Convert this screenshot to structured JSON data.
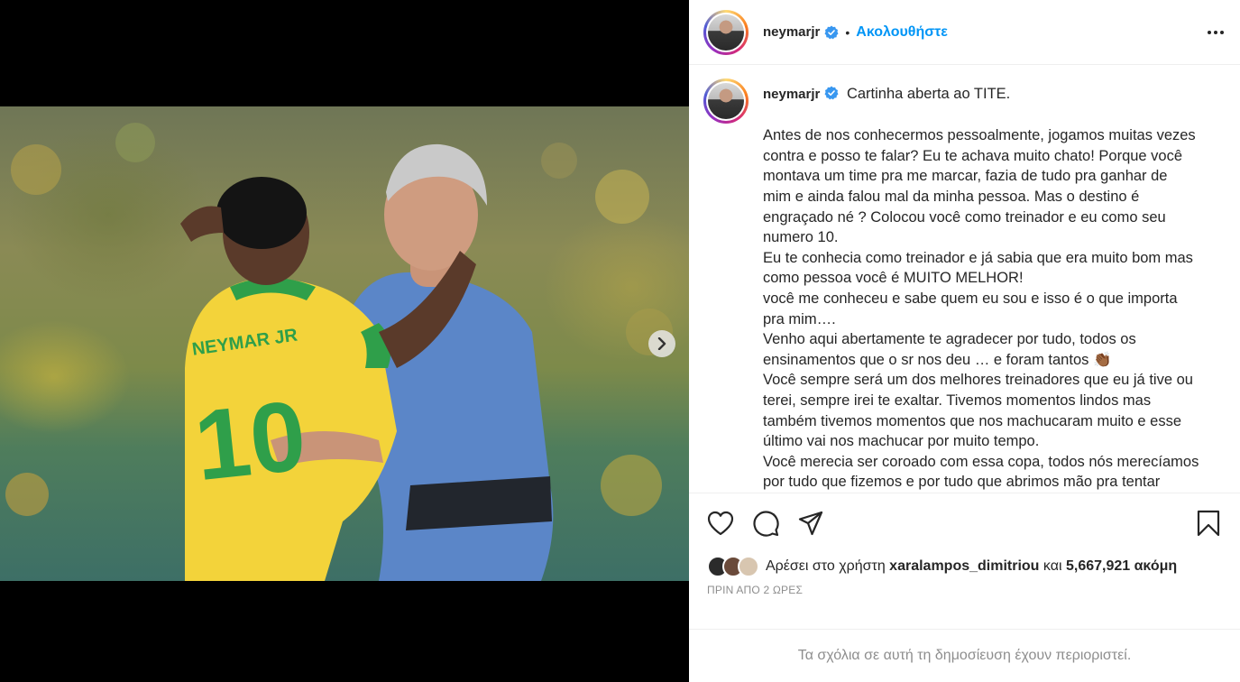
{
  "post": {
    "username": "neymarjr",
    "follow_label": "Ακολουθήστε",
    "separator": "•",
    "caption_title": "Cartinha aberta ao TITE.",
    "caption_lines": [
      "Antes de nos conhecermos pessoalmente, jogamos muitas vezes",
      "contra e posso te falar? Eu te achava muito chato! Porque você",
      "montava um time pra me marcar, fazia de tudo pra ganhar de",
      "mim e ainda falou mal da minha pessoa. Mas o destino é",
      "engraçado né ? Colocou você como treinador e eu como seu",
      "numero 10.",
      "Eu te conhecia como treinador e já sabia que era muito bom mas",
      "como pessoa você é MUITO MELHOR!",
      "você me conheceu e sabe quem eu sou e isso é o que importa",
      "pra mim….",
      "Venho aqui abertamente te agradecer por tudo, todos os",
      "ensinamentos que o sr nos deu … e foram tantos 👏🏾",
      "Você sempre será um dos melhores treinadores que eu já tive ou",
      "terei, sempre irei te exaltar. Tivemos momentos lindos mas",
      "também tivemos momentos que nos machucaram muito e esse",
      "último vai nos machucar por muito tempo.",
      "Você merecia ser coroado com essa copa, todos nós merecíamos",
      "por tudo que fizemos e por tudo que abrimos mão pra tentar"
    ],
    "likes_prefix": "Αρέσει στο χρήστη",
    "liked_by": "xaralampos_dimitriou",
    "likes_and": "και",
    "likes_count": "5,667,921 ακόμη",
    "time_ago": "ΠΡΙΝ ΑΠΟ 2 ΩΡΕΣ",
    "comments_disabled": "Τα σχόλια σε αυτή τη δημοσίευση έχουν περιοριστεί.",
    "jersey_name": "NEYMAR JR",
    "jersey_number": "10"
  },
  "carousel": {
    "current": 1,
    "total": 2
  },
  "icons": [
    "verified-badge-icon",
    "more-options-icon",
    "heart-icon",
    "comment-icon",
    "share-icon",
    "bookmark-icon",
    "chevron-right-icon"
  ],
  "colors": {
    "follow_blue": "#0095f6",
    "verified_blue": "#3897f0",
    "muted_gray": "#8e8e8e"
  }
}
